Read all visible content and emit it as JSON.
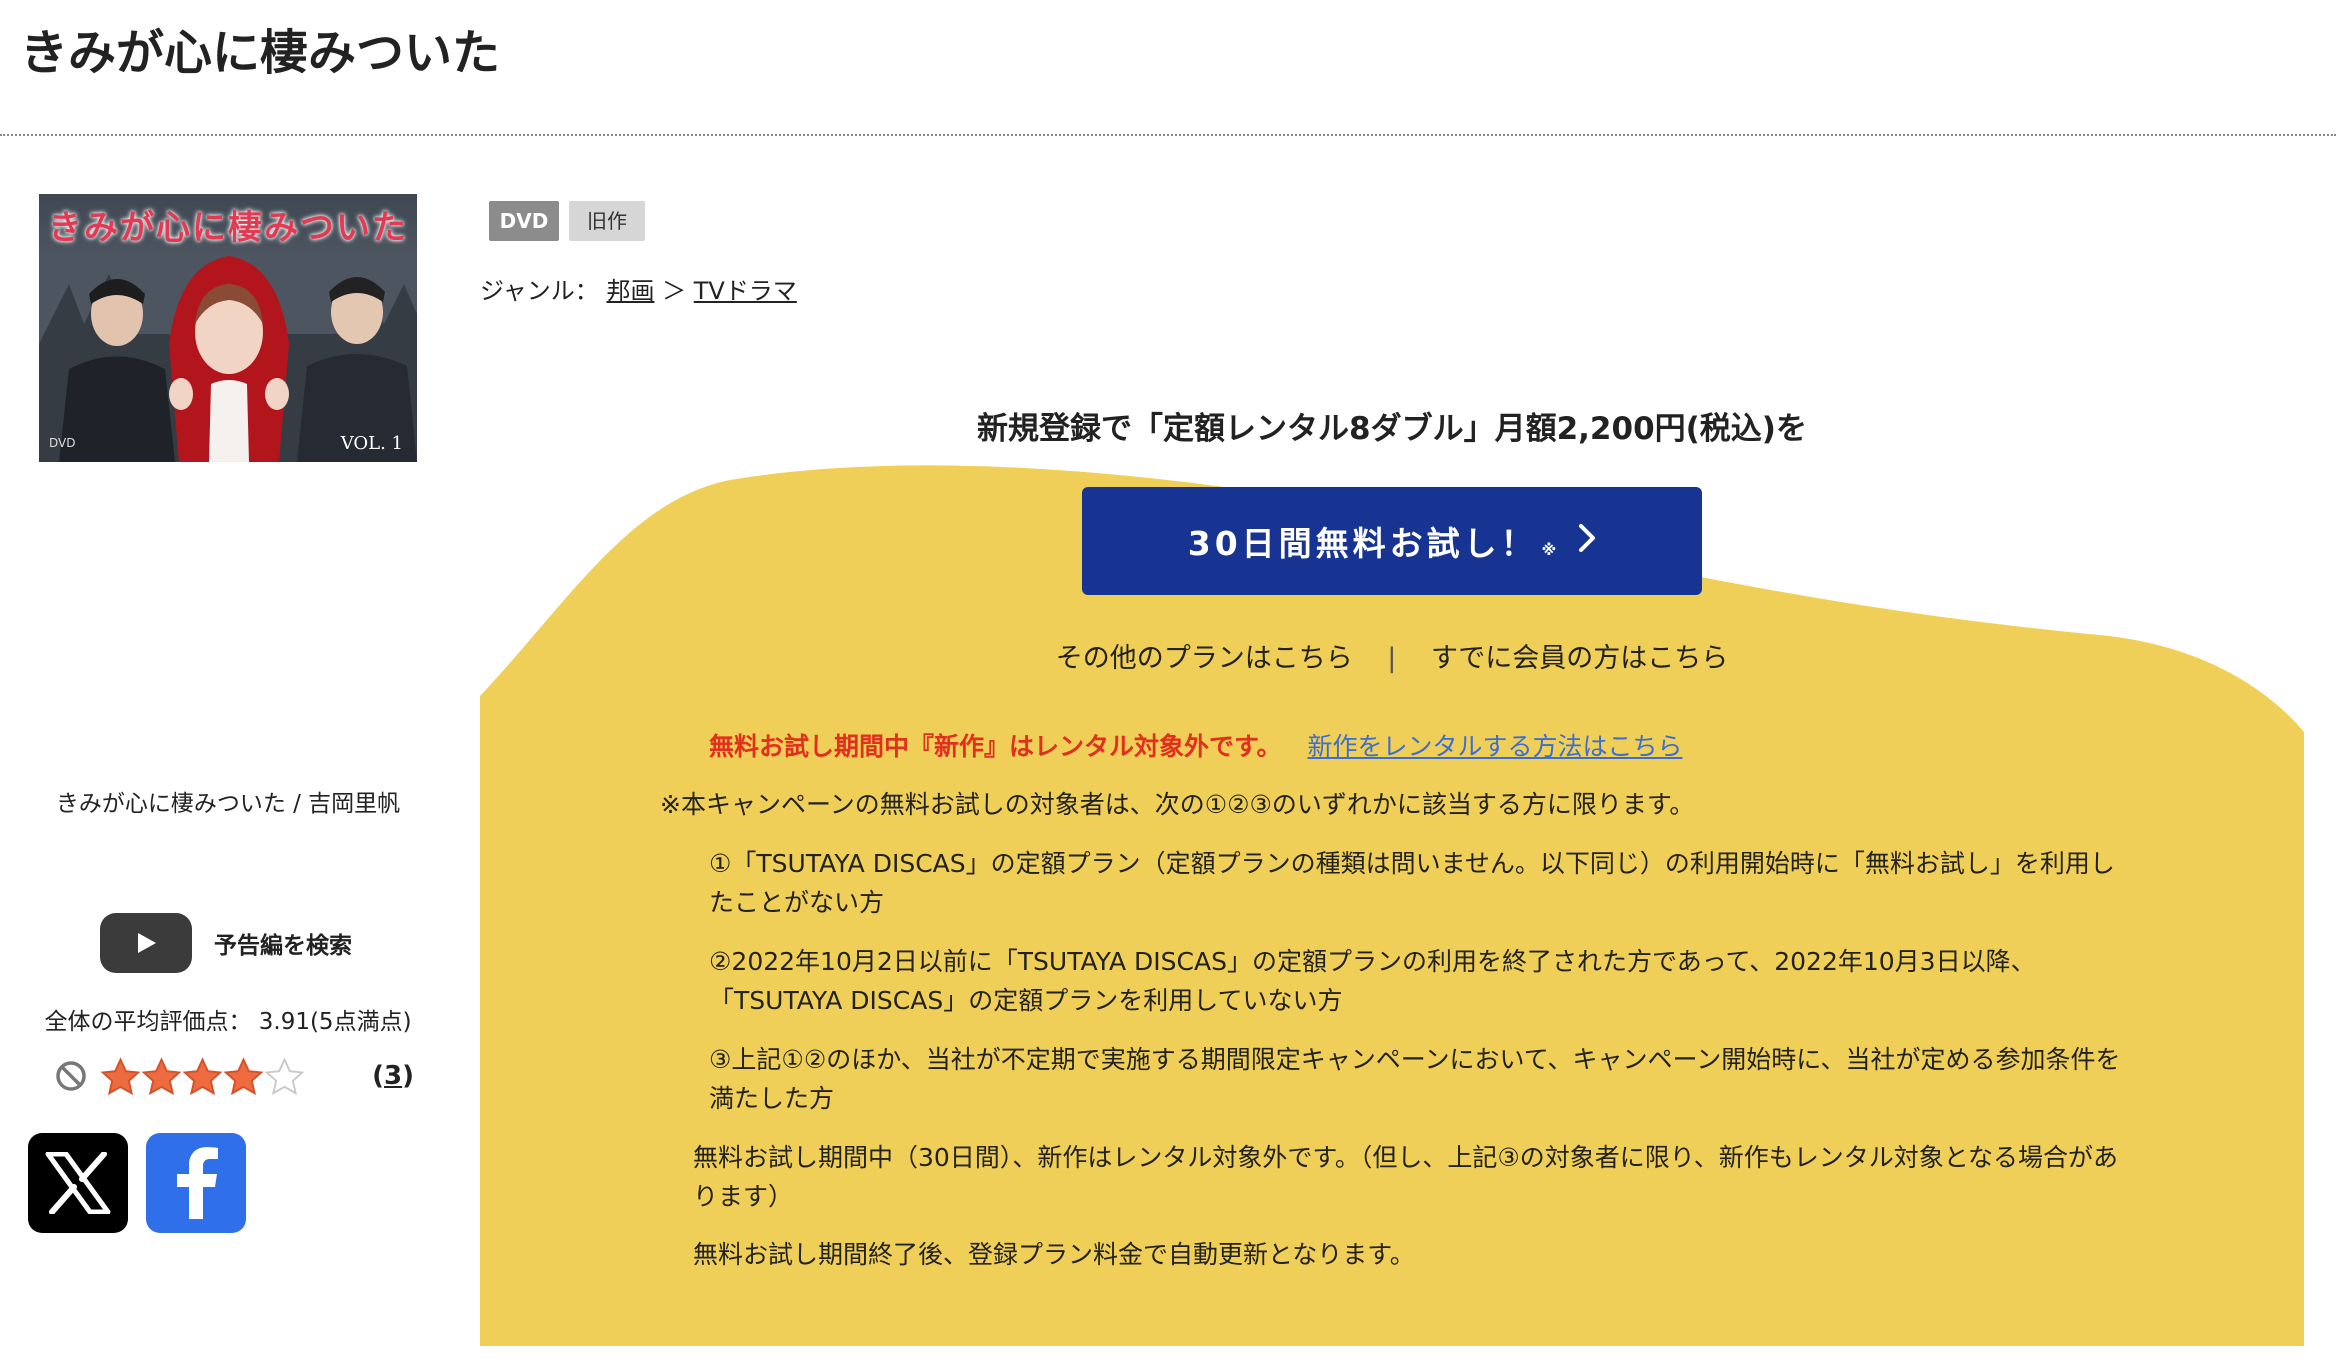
{
  "page": {
    "title": "きみが心に棲みついた"
  },
  "product": {
    "jacket_title": "きみが心に棲みついた",
    "jacket_volume": "VOL. 1",
    "jacket_format_mark": "DVD",
    "badges": [
      "DVD",
      "旧作"
    ],
    "genre_label": "ジャンル：",
    "genre_path": [
      "邦画",
      "TVドラマ"
    ],
    "genre_separator": "＞",
    "caption": "きみが心に棲みついた / 吉岡里帆"
  },
  "promo": {
    "heading": "新規登録で「定額レンタル8ダブル」月額2,200円(税込)を",
    "cta_label": "30日間無料お試し！",
    "cta_note_mark": "※",
    "other_plans_link": "その他のプランはこちら",
    "links_separator": "|",
    "member_link": "すでに会員の方はこちら",
    "warning_text": "無料お試し期間中『新作』はレンタル対象外です。",
    "warning_link": "新作をレンタルする方法はこちら",
    "conditions_intro": "※本キャンペーンの無料お試しの対象者は、次の①②③のいずれかに該当する方に限ります。",
    "conditions": [
      "①「TSUTAYA DISCAS」の定額プラン（定額プランの種類は問いません。以下同じ）の利用開始時に「無料お試し」を利用したことがない方",
      "②2022年10月2日以前に「TSUTAYA DISCAS」の定額プランの利用を終了された方であって、2022年10月3日以降、「TSUTAYA DISCAS」の定額プランを利用していない方",
      "③上記①②のほか、当社が不定期で実施する期間限定キャンペーンにおいて、キャンペーン開始時に、当社が定める参加条件を満たした方"
    ],
    "notes": [
      "無料お試し期間中（30日間）、新作はレンタル対象外です。（但し、上記③の対象者に限り、新作もレンタル対象となる場合があります）",
      "無料お試し期間終了後、登録プラン料金で自動更新となります。"
    ]
  },
  "sidebar": {
    "trailer_label": "予告編を検索",
    "rating_label": "全体の平均評価点：",
    "rating_value": "3.91(5点満点)",
    "stars": 4,
    "stars_max": 5,
    "review_count": "3",
    "share": [
      "x-icon",
      "facebook-icon"
    ]
  },
  "colors": {
    "promo_background": "#f0cf58",
    "cta_background": "#173493",
    "warning_red": "#e0301e",
    "link_blue": "#3d6fd1",
    "star_fill": "#ee6a3f",
    "facebook_blue": "#2f6fe9"
  }
}
